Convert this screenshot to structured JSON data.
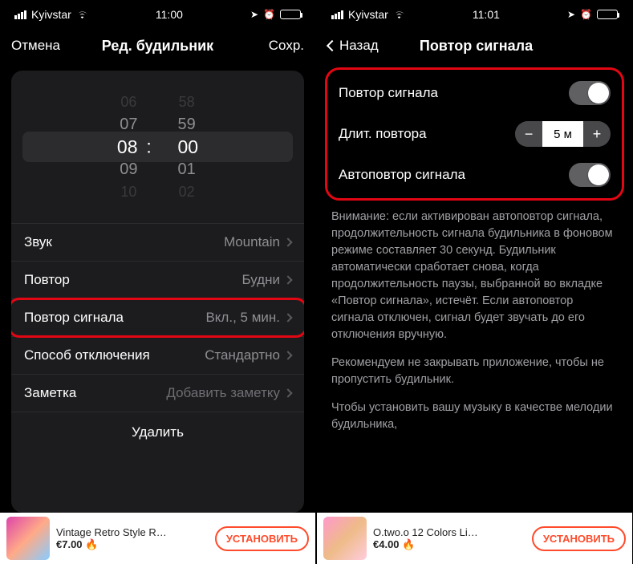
{
  "left": {
    "status": {
      "carrier": "Kyivstar",
      "time": "11:00"
    },
    "nav": {
      "cancel": "Отмена",
      "title": "Ред. будильник",
      "save": "Сохр."
    },
    "picker": {
      "hours": [
        "06",
        "07",
        "08",
        "09",
        "10"
      ],
      "minutes": [
        "58",
        "59",
        "00",
        "01",
        "02"
      ]
    },
    "rows": {
      "sound": {
        "label": "Звук",
        "value": "Mountain"
      },
      "repeat": {
        "label": "Повтор",
        "value": "Будни"
      },
      "snooze": {
        "label": "Повтор сигнала",
        "value": "Вкл., 5 мин."
      },
      "dismiss": {
        "label": "Способ отключения",
        "value": "Стандартно"
      },
      "note": {
        "label": "Заметка",
        "value": "Добавить заметку"
      }
    },
    "delete": "Удалить",
    "ad": {
      "title": "Vintage Retro Style R…",
      "price": "€7.00 🔥",
      "cta": "УСТАНОВИТЬ"
    }
  },
  "right": {
    "status": {
      "carrier": "Kyivstar",
      "time": "11:01"
    },
    "nav": {
      "back": "Назад",
      "title": "Повтор сигнала"
    },
    "settings": {
      "snooze": {
        "label": "Повтор сигнала"
      },
      "duration": {
        "label": "Длит. повтора",
        "value": "5 м"
      },
      "auto": {
        "label": "Автоповтор сигнала"
      }
    },
    "info": {
      "p1": "Внимание: если активирован автоповтор сигнала, продолжительность сигнала будильника в фоновом режиме составляет 30 секунд. Будильник автоматически сработает снова, когда продолжительность паузы, выбранной во вкладке «Повтор сигнала», истечёт. Если автоповтор сигнала отключен, сигнал будет звучать до его отключения вручную.",
      "p2": "Рекомендуем не закрывать приложение, чтобы не пропустить будильник.",
      "p3": "Чтобы установить вашу музыку в качестве мелодии будильника,"
    },
    "ad": {
      "title": "O.two.o 12 Colors Li…",
      "price": "€4.00 🔥",
      "cta": "УСТАНОВИТЬ"
    }
  }
}
